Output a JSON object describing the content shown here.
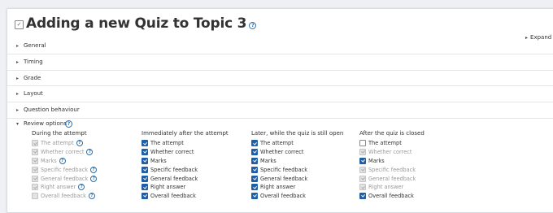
{
  "page": {
    "title": "Adding a new Quiz to Topic 3",
    "expand_all": "Expand all"
  },
  "sections": [
    {
      "label": "General"
    },
    {
      "label": "Timing"
    },
    {
      "label": "Grade"
    },
    {
      "label": "Layout"
    },
    {
      "label": "Question behaviour"
    }
  ],
  "review_options": {
    "label": "Review options",
    "columns": [
      {
        "title": "During the attempt",
        "options": [
          {
            "label": "The attempt",
            "checked": true,
            "disabled": true,
            "help": true
          },
          {
            "label": "Whether correct",
            "checked": true,
            "disabled": true,
            "help": true
          },
          {
            "label": "Marks",
            "checked": true,
            "disabled": true,
            "help": true
          },
          {
            "label": "Specific feedback",
            "checked": true,
            "disabled": true,
            "help": true
          },
          {
            "label": "General feedback",
            "checked": true,
            "disabled": true,
            "help": true
          },
          {
            "label": "Right answer",
            "checked": true,
            "disabled": true,
            "help": true
          },
          {
            "label": "Overall feedback",
            "checked": false,
            "disabled": true,
            "help": true
          }
        ]
      },
      {
        "title": "Immediately after the attempt",
        "options": [
          {
            "label": "The attempt",
            "checked": true,
            "disabled": false,
            "help": false
          },
          {
            "label": "Whether correct",
            "checked": true,
            "disabled": false,
            "help": false
          },
          {
            "label": "Marks",
            "checked": true,
            "disabled": false,
            "help": false
          },
          {
            "label": "Specific feedback",
            "checked": true,
            "disabled": false,
            "help": false
          },
          {
            "label": "General feedback",
            "checked": true,
            "disabled": false,
            "help": false
          },
          {
            "label": "Right answer",
            "checked": true,
            "disabled": false,
            "help": false
          },
          {
            "label": "Overall feedback",
            "checked": true,
            "disabled": false,
            "help": false
          }
        ]
      },
      {
        "title": "Later, while the quiz is still open",
        "options": [
          {
            "label": "The attempt",
            "checked": true,
            "disabled": false,
            "help": false
          },
          {
            "label": "Whether correct",
            "checked": true,
            "disabled": false,
            "help": false
          },
          {
            "label": "Marks",
            "checked": true,
            "disabled": false,
            "help": false
          },
          {
            "label": "Specific feedback",
            "checked": true,
            "disabled": false,
            "help": false
          },
          {
            "label": "General feedback",
            "checked": true,
            "disabled": false,
            "help": false
          },
          {
            "label": "Right answer",
            "checked": true,
            "disabled": false,
            "help": false
          },
          {
            "label": "Overall feedback",
            "checked": true,
            "disabled": false,
            "help": false
          }
        ]
      },
      {
        "title": "After the quiz is closed",
        "options": [
          {
            "label": "The attempt",
            "checked": false,
            "disabled": false,
            "help": false
          },
          {
            "label": "Whether correct",
            "checked": true,
            "disabled": true,
            "help": false
          },
          {
            "label": "Marks",
            "checked": true,
            "disabled": false,
            "help": false
          },
          {
            "label": "Specific feedback",
            "checked": true,
            "disabled": true,
            "help": false
          },
          {
            "label": "General feedback",
            "checked": true,
            "disabled": true,
            "help": false
          },
          {
            "label": "Right answer",
            "checked": true,
            "disabled": true,
            "help": false
          },
          {
            "label": "Overall feedback",
            "checked": true,
            "disabled": false,
            "help": false
          }
        ]
      }
    ]
  },
  "icons": {
    "quiz_icon": "quiz-checkbox-icon",
    "help_icon": "question-circle-icon",
    "section_toggle": "chevron-right-icon",
    "review_toggle": "chevron-down-icon"
  },
  "colors": {
    "accent": "#1f5fa8",
    "help": "#2f6ea5"
  }
}
